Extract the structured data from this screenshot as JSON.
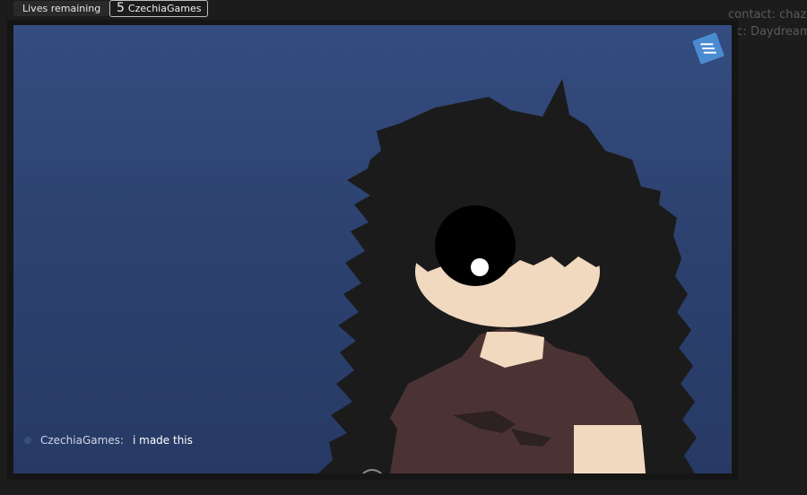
{
  "hud": {
    "lives_label": "Lives remaining",
    "lives_count": "5",
    "player_name": "CzechiaGames"
  },
  "side_info": {
    "contact": "contact: chazu",
    "music": "music: Daydream"
  },
  "menu": {
    "icon": "hamburger-menu-icon"
  },
  "chat": {
    "name": "CzechiaGames:",
    "message": "i made this"
  },
  "colors": {
    "background": "#1c1c1c",
    "sky_top": "#344c7f",
    "sky_bottom": "#273a65",
    "hair": "#1b1b1b",
    "skin": "#f1d9c0",
    "shirt": "#4c3333",
    "menu_accent": "#4a8bd1"
  }
}
